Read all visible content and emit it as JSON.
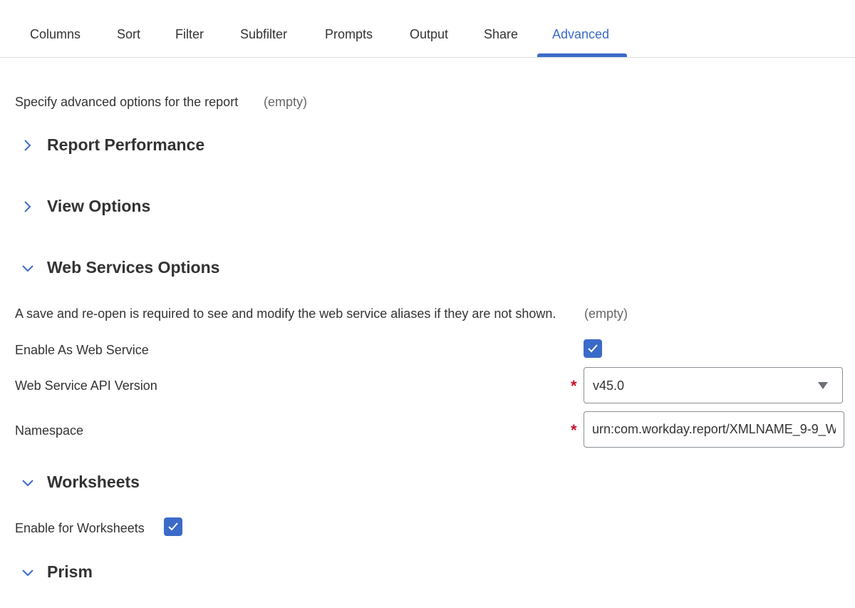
{
  "tabs": [
    {
      "label": "Columns"
    },
    {
      "label": "Sort"
    },
    {
      "label": "Filter"
    },
    {
      "label": "Subfilter"
    },
    {
      "label": "Prompts"
    },
    {
      "label": "Output"
    },
    {
      "label": "Share"
    },
    {
      "label": "Advanced"
    }
  ],
  "active_tab": "Advanced",
  "intro": {
    "label": "Specify advanced options for the report",
    "value": "(empty)"
  },
  "sections": {
    "report_performance": {
      "title": "Report Performance",
      "expanded": false
    },
    "view_options": {
      "title": "View Options",
      "expanded": false
    },
    "web_services": {
      "title": "Web Services Options",
      "expanded": true,
      "note": "A save and re-open is required to see and modify the web service aliases if they are not shown.",
      "note_value": "(empty)",
      "enable_label": "Enable As Web Service",
      "enable_checked": true,
      "api_version_label": "Web Service API Version",
      "api_version_value": "v45.0",
      "namespace_label": "Namespace",
      "namespace_value": "urn:com.workday.report/XMLNAME_9-9_W"
    },
    "worksheets": {
      "title": "Worksheets",
      "expanded": true,
      "enable_label": "Enable for Worksheets",
      "enable_checked": true
    },
    "prism": {
      "title": "Prism",
      "expanded": true
    }
  },
  "required_marker": "*",
  "colors": {
    "accent": "#3b6ac9",
    "required": "#c8102e",
    "text": "#333333"
  }
}
